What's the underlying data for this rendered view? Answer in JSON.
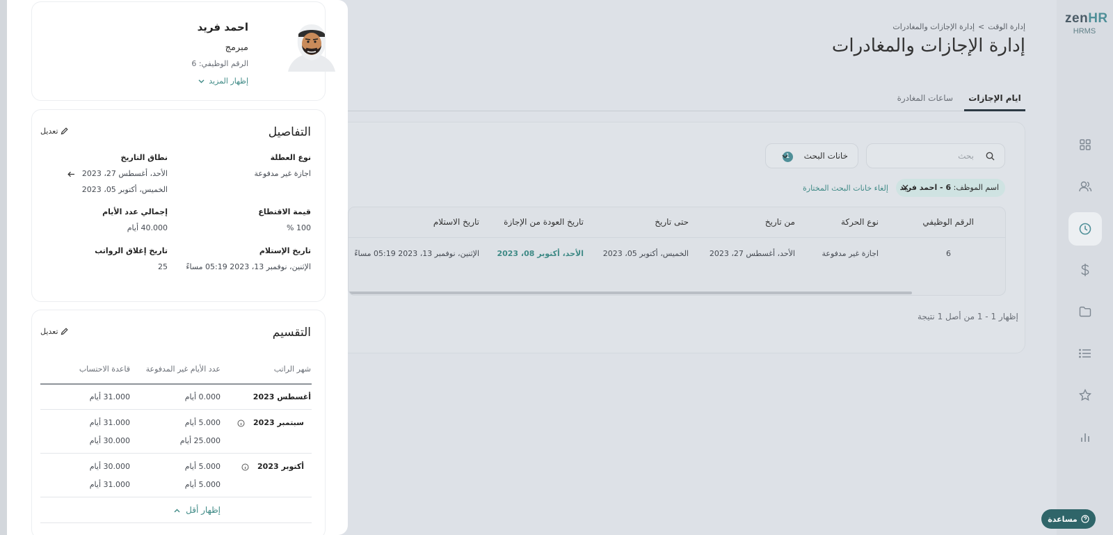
{
  "app": {
    "logo_main": "zen",
    "logo_accent": "HR",
    "logo_sub": "HRMS"
  },
  "sidebar": {
    "items": [
      {
        "icon": "grid-icon"
      },
      {
        "icon": "users-icon"
      },
      {
        "icon": "clock-icon",
        "active": true
      },
      {
        "icon": "dollar-icon"
      },
      {
        "icon": "folder-icon"
      },
      {
        "icon": "list-icon"
      },
      {
        "icon": "star-icon"
      },
      {
        "icon": "bar-chart-icon"
      }
    ]
  },
  "header": {
    "breadcrumb": [
      "إدارة الوقت",
      "إدارة الإجازات والمغادرات"
    ],
    "breadcrumb_sep": ">",
    "title": "إدارة الإجازات والمغادرات"
  },
  "tabs": [
    {
      "label": "ايام الإجازات",
      "active": true
    },
    {
      "label": "ساعات المغادرة"
    }
  ],
  "search": {
    "placeholder": "بحث"
  },
  "filter": {
    "label": "خانات البحث",
    "count": "1"
  },
  "active_filter": {
    "label": "اسم الموظف:",
    "value": "6 - احمد فريد"
  },
  "clear_filters": "إلغاء خانات البحث المختارة",
  "table": {
    "columns": [
      "الرقم الوظيفي",
      "نوع الحركة",
      "من تاريخ",
      "حتى تاريخ",
      "تاريخ العودة من الإجازة",
      "تاريخ الاستلام"
    ],
    "rows": [
      [
        "6",
        "اجازة غير مدفوعة",
        "الأحد، أغسطس 27، 2023",
        "الخميس، أكتوبر 05، 2023",
        "الأحد، أكتوبر 08، 2023",
        "الإثنين، نوفمبر 13، 2023 05:19 مساءً"
      ]
    ]
  },
  "pagination": "إظهار 1 - 1 من أصل 1 نتيجة",
  "panel": {
    "employee": {
      "name": "احمد فريد",
      "job": "مبرمج",
      "id_text": "الرقم الوظيفي: 6",
      "show_more": "إظهار المزيد"
    },
    "details": {
      "title": "التفاصيل",
      "edit": "تعديل",
      "leave_type_label": "نوع العطلة",
      "leave_type": "اجازة غير مدفوعة",
      "date_range_label": "نطاق التاريخ",
      "date_from": "الأحد، أغسطس 27، 2023",
      "date_to": "الخميس، أكتوبر 05، 2023",
      "deduction_label": "قيمة الاقتطاع",
      "deduction": "100 %",
      "total_days_label": "إجمالي عدد الأيام",
      "total_days": "40.000 أيام",
      "received_label": "تاريخ الإستلام",
      "received": "الإثنين، نوفمبر 13، 2023 05:19 مساءً",
      "payroll_close_label": "تاريخ إغلاق الرواتب",
      "payroll_close": "25"
    },
    "division": {
      "title": "التقسيم",
      "edit": "تعديل",
      "headers": [
        "شهر الراتب",
        "عدد الأيام غير المدفوعة",
        "قاعدة الاحتساب"
      ],
      "rows": [
        {
          "month": "أغسطس 2023",
          "unpaid": [
            "0.000 أيام"
          ],
          "basis": [
            "31.000 أيام"
          ],
          "info": false
        },
        {
          "month": "سبتمبر 2023",
          "unpaid": [
            "5.000 أيام",
            "25.000 أيام"
          ],
          "basis": [
            "31.000 أيام",
            "30.000 أيام"
          ],
          "info": true
        },
        {
          "month": "أكتوبر 2023",
          "unpaid": [
            "5.000 أيام",
            "5.000 أيام"
          ],
          "basis": [
            "30.000 أيام",
            "31.000 أيام"
          ],
          "info": true
        }
      ],
      "show_less": "إظهار أقل"
    }
  },
  "help": {
    "label": "مساعدة"
  },
  "colors": {
    "accent": "#4f8f98",
    "link": "#3f8a86",
    "help_bg": "#2f6569"
  }
}
